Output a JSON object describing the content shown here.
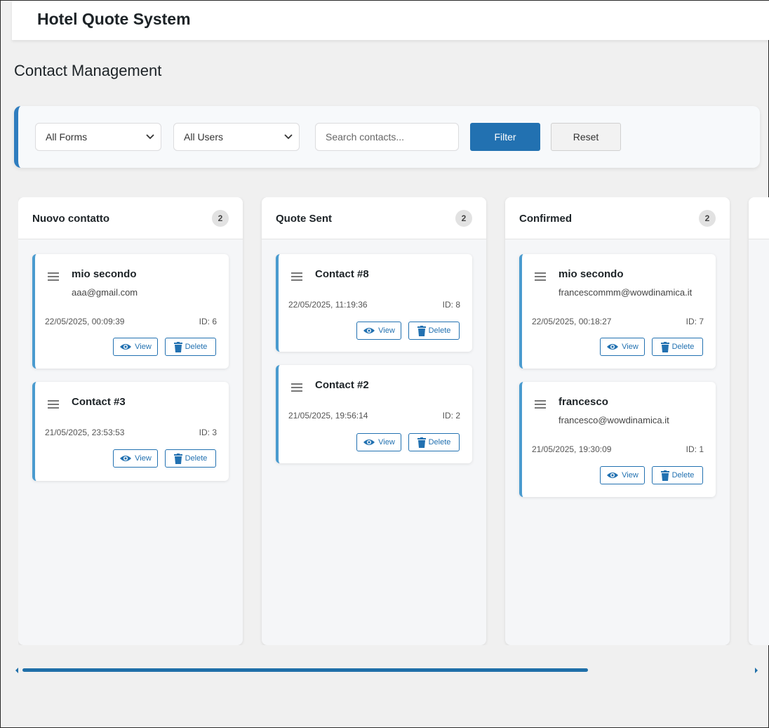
{
  "app": {
    "title": "Hotel Quote System"
  },
  "page": {
    "title": "Contact Management"
  },
  "filters": {
    "forms_select": "All Forms",
    "users_select": "All Users",
    "search_placeholder": "Search contacts...",
    "filter_label": "Filter",
    "reset_label": "Reset"
  },
  "columns": [
    {
      "title": "Nuovo contatto",
      "count": "2",
      "cards": [
        {
          "name": "mio secondo",
          "email": "aaa@gmail.com",
          "date": "22/05/2025, 00:09:39",
          "id": "ID: 6",
          "view": "View",
          "delete": "Delete"
        },
        {
          "name": "Contact #3",
          "email": "",
          "date": "21/05/2025, 23:53:53",
          "id": "ID: 3",
          "view": "View",
          "delete": "Delete"
        }
      ]
    },
    {
      "title": "Quote Sent",
      "count": "2",
      "cards": [
        {
          "name": "Contact #8",
          "email": "",
          "date": "22/05/2025, 11:19:36",
          "id": "ID: 8",
          "view": "View",
          "delete": "Delete"
        },
        {
          "name": "Contact #2",
          "email": "",
          "date": "21/05/2025, 19:56:14",
          "id": "ID: 2",
          "view": "View",
          "delete": "Delete"
        }
      ]
    },
    {
      "title": "Confirmed",
      "count": "2",
      "cards": [
        {
          "name": "mio secondo",
          "email": "francescommm@wowdinamica.it",
          "date": "22/05/2025, 00:18:27",
          "id": "ID: 7",
          "view": "View",
          "delete": "Delete"
        },
        {
          "name": "francesco",
          "email": "francesco@wowdinamica.it",
          "date": "21/05/2025, 19:30:09",
          "id": "ID: 1",
          "view": "View",
          "delete": "Delete"
        }
      ]
    }
  ],
  "icons": {
    "view": "eye-icon",
    "delete": "trash-icon",
    "drag": "drag-handle-icon",
    "dropdown": "chevron-down-icon"
  },
  "colors": {
    "primary": "#2271b1",
    "card_accent": "#4a9bcf",
    "scrollbar": "#1f6fa9"
  }
}
